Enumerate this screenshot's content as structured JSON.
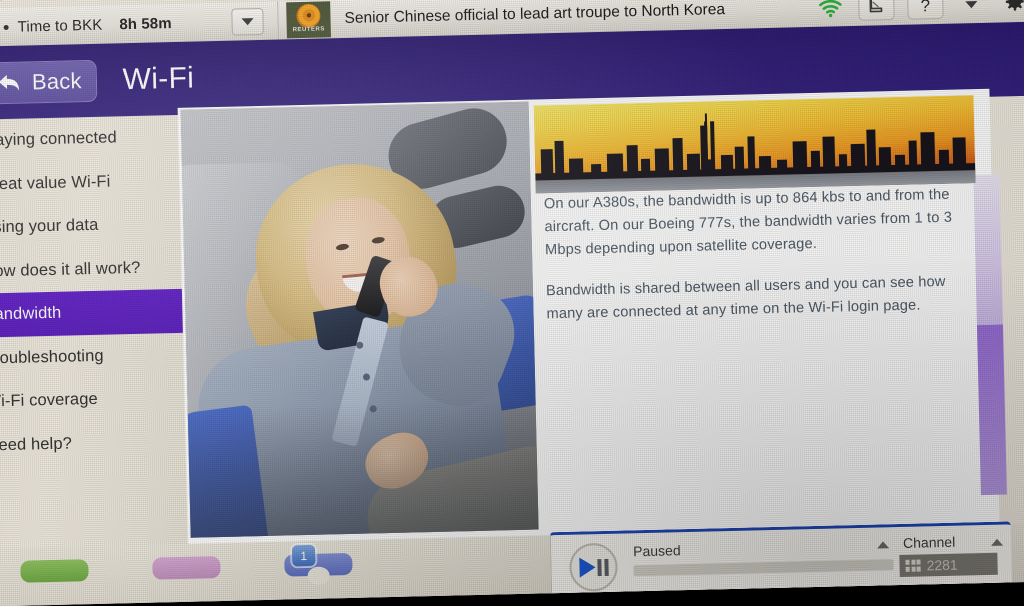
{
  "statusbar": {
    "flight_bullet": "•",
    "flight_label": "Time to BKK",
    "flight_time": "8h 58m",
    "dropdown_icon": "chevron-down-icon",
    "news_source": "REUTERS",
    "headline": "Senior Chinese official to lead art troupe to North Korea",
    "icons": [
      {
        "name": "wifi-icon",
        "glyph": "wifi"
      },
      {
        "name": "seat-icon",
        "glyph": "seat"
      },
      {
        "name": "help-icon",
        "glyph": "?"
      },
      {
        "name": "chevron-down-icon",
        "glyph": "caret"
      },
      {
        "name": "settings-gear-icon",
        "glyph": "gear"
      }
    ]
  },
  "header": {
    "back_label": "Back",
    "back_icon": "back-arrow-icon",
    "title": "Wi-Fi"
  },
  "sidebar": {
    "items": [
      {
        "label": "Staying connected",
        "active": false
      },
      {
        "label": "Great value Wi-Fi",
        "active": false
      },
      {
        "label": "Using your data",
        "active": false
      },
      {
        "label": "How does it all work?",
        "active": false
      },
      {
        "label": "Bandwidth",
        "active": true
      },
      {
        "label": "Troubleshooting",
        "active": false
      },
      {
        "label": "Wi-Fi coverage",
        "active": false
      },
      {
        "label": "Need help?",
        "active": false
      }
    ]
  },
  "content": {
    "photo_alt": "woman-on-phone-in-aircraft-seat",
    "banner_alt": "dubai-skyline-at-sunset",
    "paragraph_1": "On our A380s, the bandwidth is up to 864 kbs to and from the aircraft. On our Boeing 777s, the bandwidth varies from 1 to 3 Mbps depending upon satellite coverage.",
    "paragraph_2": "Bandwidth is shared between all users and you can see how many are connected at any time on the Wi-Fi login page."
  },
  "bottom": {
    "page_number": "1",
    "dock_buttons": [
      {
        "name": "dock-button-green",
        "color": "#79b34d"
      },
      {
        "name": "dock-button-pink",
        "color": "#c99bc7"
      },
      {
        "name": "dock-button-blue",
        "color": "#6c7dcb"
      }
    ]
  },
  "player": {
    "play_pause_icon": "play-pause-icon",
    "status": "Paused",
    "channel_label": "Channel",
    "channel_number": "2281",
    "volume_up_icon": "caret-up-icon",
    "channel_up_icon": "caret-up-icon"
  },
  "colors": {
    "header_purple": "#2f1d78",
    "active_item_purple": "#5c19c6",
    "back_button_purple": "#6d5fb0",
    "panel_cream": "#e9e4d8",
    "body_text": "#4d5a66",
    "wifi_green": "#2eb33b",
    "player_accent_blue": "#1b44b8"
  }
}
